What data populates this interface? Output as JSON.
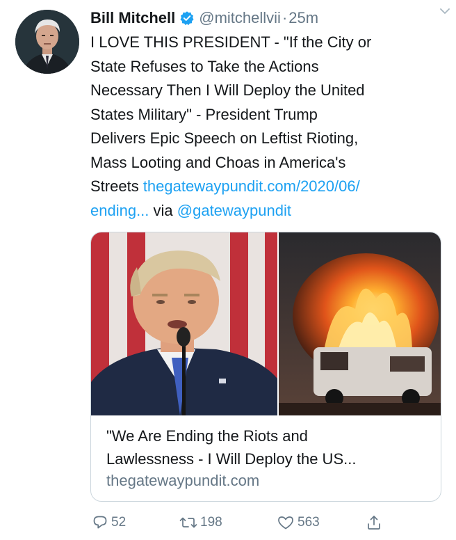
{
  "tweet": {
    "author_name": "Bill Mitchell",
    "handle": "@mitchellvii",
    "separator": "·",
    "time": "25m",
    "text_line1": "I LOVE THIS PRESIDENT - \"If the City or",
    "text_line2": "State Refuses to Take the Actions",
    "text_line3": "Necessary Then I Will Deploy the United",
    "text_line4": "States Military\" - President Trump",
    "text_line5": "Delivers Epic Speech on Leftist Rioting,",
    "text_line6": "Mass Looting and Choas in America's",
    "text_line7_prefix": "Streets ",
    "link_part1": "thegatewaypundit.com/2020/06/",
    "link_part2": "ending...",
    "via_text": " via ",
    "mention": "@gatewaypundit"
  },
  "card": {
    "title_line1": "\"We Are Ending the Riots and",
    "title_line2": "Lawlessness - I Will Deploy the US...",
    "domain": "thegatewaypundit.com"
  },
  "actions": {
    "replies": "52",
    "retweets": "198",
    "likes": "563"
  },
  "icons": {
    "verified": "verified-badge-icon",
    "caret": "chevron-down-icon",
    "reply": "reply-icon",
    "retweet": "retweet-icon",
    "like": "heart-icon",
    "share": "share-icon"
  },
  "colors": {
    "link": "#1da1f2",
    "secondary_text": "#657786",
    "border": "#ccd6dd",
    "verified": "#1da1f2"
  }
}
